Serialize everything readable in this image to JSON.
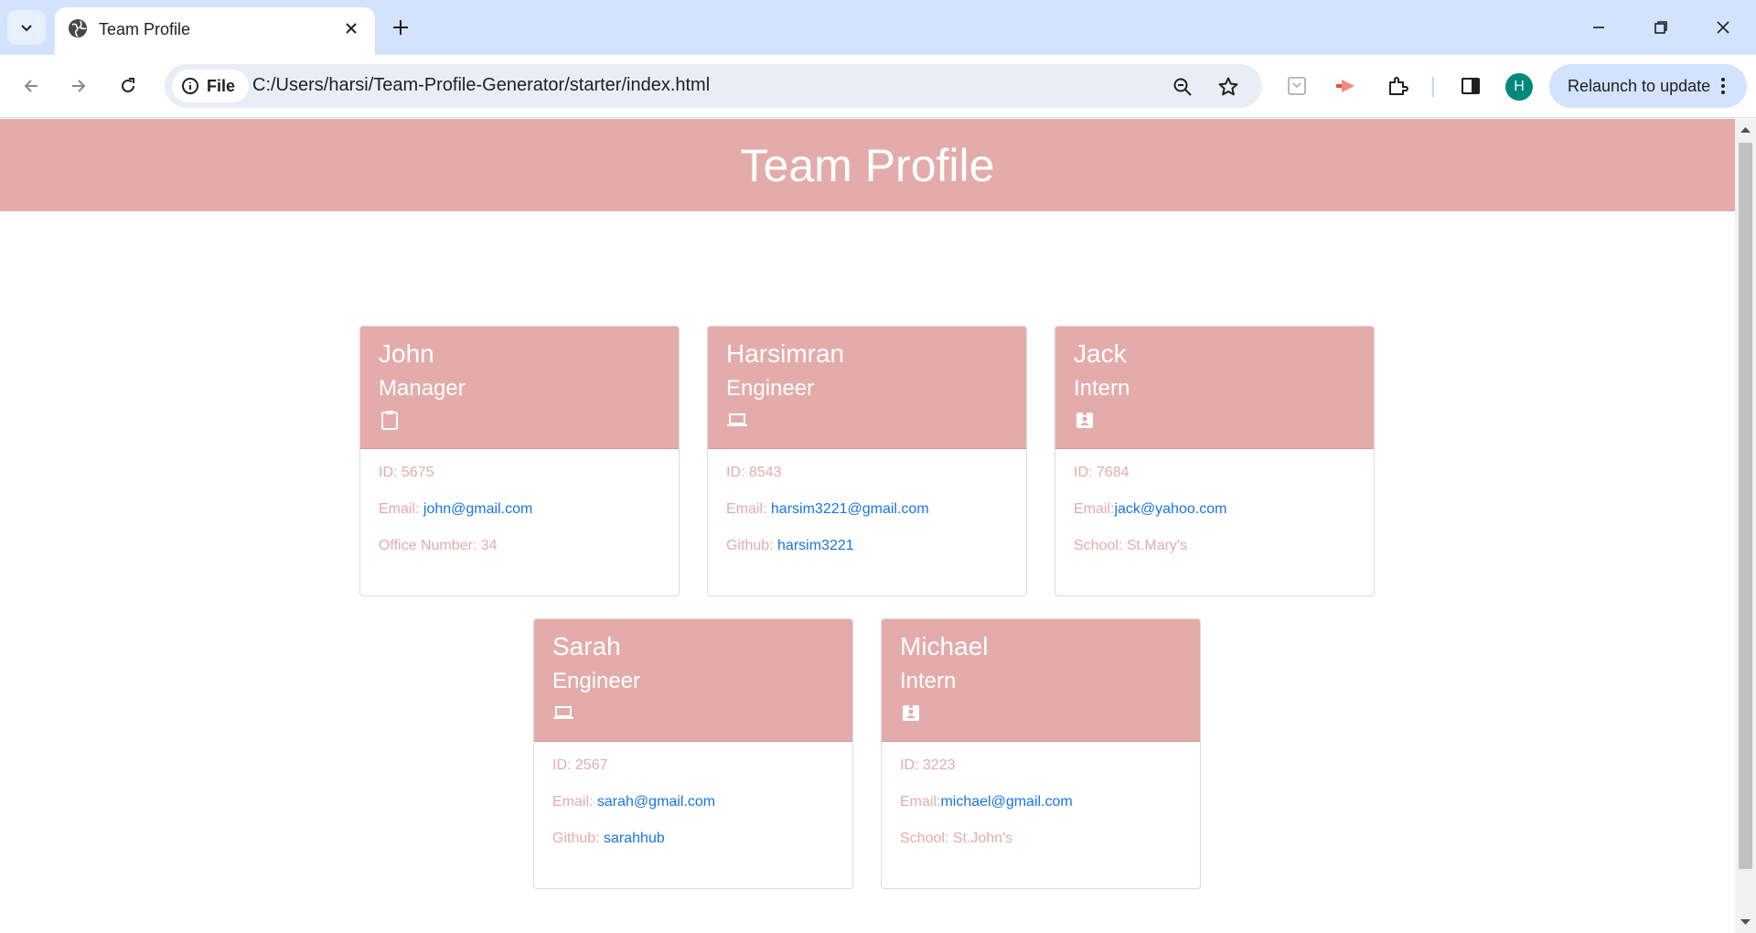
{
  "browser": {
    "tab_title": "Team Profile",
    "url": "C:/Users/harsi/Team-Profile-Generator/starter/index.html",
    "site_chip_label": "File",
    "avatar_letter": "H",
    "relaunch_label": "Relaunch to update"
  },
  "page": {
    "header_title": "Team Profile",
    "colors": {
      "accent": "#e3acaa",
      "link": "#1a73e8"
    },
    "cards": [
      {
        "name": "John",
        "role": "Manager",
        "icon": "clipboard-icon",
        "lines": [
          {
            "label": "ID: 5675",
            "link": ""
          },
          {
            "label": "Email: ",
            "link": "john@gmail.com"
          },
          {
            "label": "Office Number: 34",
            "link": ""
          }
        ]
      },
      {
        "name": "Harsimran",
        "role": "Engineer",
        "icon": "laptop-icon",
        "lines": [
          {
            "label": "ID: 8543",
            "link": ""
          },
          {
            "label": "Email: ",
            "link": "harsim3221@gmail.com"
          },
          {
            "label": "Github: ",
            "link": "harsim3221"
          }
        ]
      },
      {
        "name": "Jack",
        "role": "Intern",
        "icon": "id-badge-icon",
        "lines": [
          {
            "label": "ID: 7684",
            "link": ""
          },
          {
            "label": "Email:",
            "link": "jack@yahoo.com"
          },
          {
            "label": "School: St.Mary's",
            "link": ""
          }
        ]
      },
      {
        "name": "Sarah",
        "role": "Engineer",
        "icon": "laptop-icon",
        "lines": [
          {
            "label": "ID: 2567",
            "link": ""
          },
          {
            "label": "Email: ",
            "link": "sarah@gmail.com"
          },
          {
            "label": "Github: ",
            "link": "sarahhub"
          }
        ]
      },
      {
        "name": "Michael",
        "role": "Intern",
        "icon": "id-badge-icon",
        "lines": [
          {
            "label": "ID: 3223",
            "link": ""
          },
          {
            "label": "Email:",
            "link": "michael@gmail.com"
          },
          {
            "label": "School: St.John's",
            "link": ""
          }
        ]
      }
    ]
  }
}
